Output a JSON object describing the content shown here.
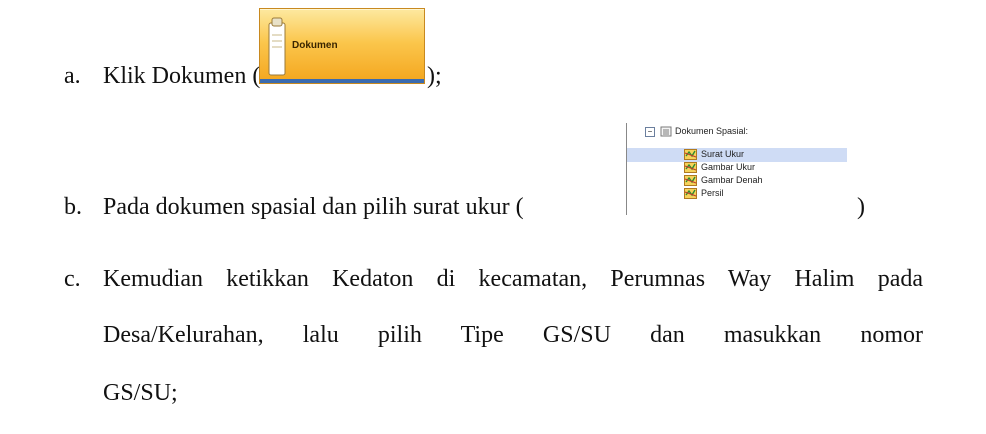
{
  "items": {
    "a": {
      "marker": "a.",
      "text_before": "Klik Dokumen (",
      "text_after": ");"
    },
    "b": {
      "marker": "b.",
      "text_before": "Pada dokumen spasial dan pilih surat ukur (",
      "text_after": ")"
    },
    "c": {
      "marker": "c.",
      "line1": "Kemudian ketikkan Kedaton di kecamatan, Perumnas Way Halim pada",
      "line2": "Desa/Kelurahan, lalu pilih Tipe GS/SU dan masukkan nomor",
      "line3": "GS/SU;"
    }
  },
  "dokumen_button": {
    "label": "Dokumen",
    "icon": "document-icon"
  },
  "tree": {
    "root": {
      "label": "Dokumen Spasial:",
      "icon": "folder-icon",
      "toggle": "−"
    },
    "children": [
      {
        "label": "Surat Ukur",
        "icon": "map-icon",
        "selected": true
      },
      {
        "label": "Gambar Ukur",
        "icon": "map-icon",
        "selected": false
      },
      {
        "label": "Gambar Denah",
        "icon": "map-icon",
        "selected": false
      },
      {
        "label": "Persil",
        "icon": "map-icon",
        "selected": false
      }
    ]
  }
}
